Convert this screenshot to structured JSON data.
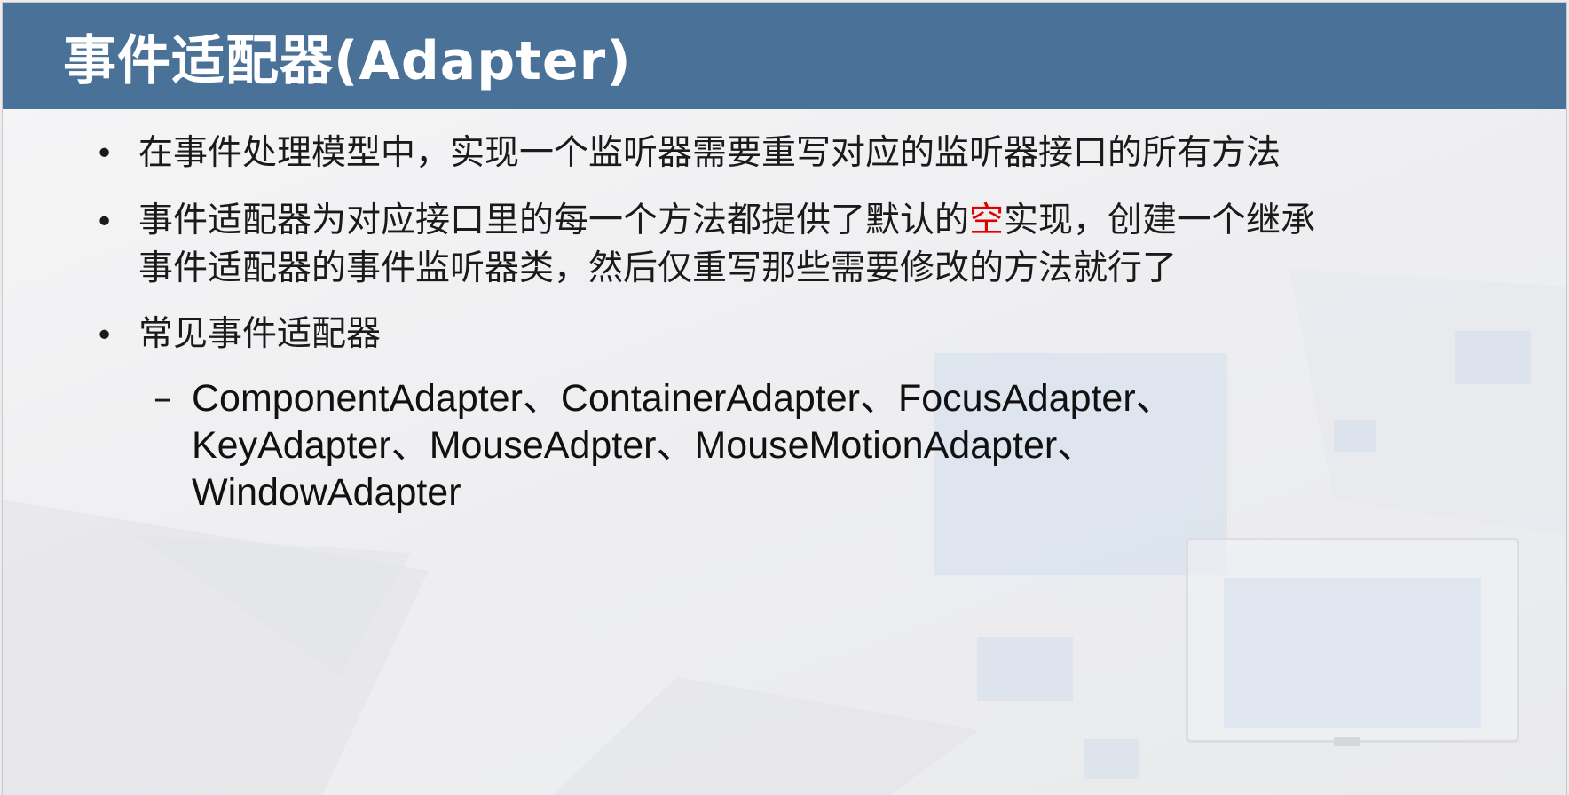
{
  "slide": {
    "title": "事件适配器(Adapter)",
    "bullet_glyph": "•",
    "dash_glyph": "–",
    "accent_color": "#e00000",
    "header_color": "#4a7299",
    "bullets": [
      {
        "text": "在事件处理模型中，实现一个监听器需要重写对应的监听器接口的所有方法"
      },
      {
        "line1_pre": "事件适配器为对应接口里的每一个方法都提供了默认的",
        "line1_red": "空",
        "line1_post": "实现，创建一个继承",
        "line2": "事件适配器的事件监听器类，然后仅重写那些需要修改的方法就行了"
      },
      {
        "text": "常见事件适配器"
      }
    ],
    "sub_bullet": {
      "line1": "ComponentAdapter、ContainerAdapter、FocusAdapter、",
      "line2": "KeyAdapter、MouseAdpter、MouseMotionAdapter、",
      "line3": "WindowAdapter"
    }
  }
}
